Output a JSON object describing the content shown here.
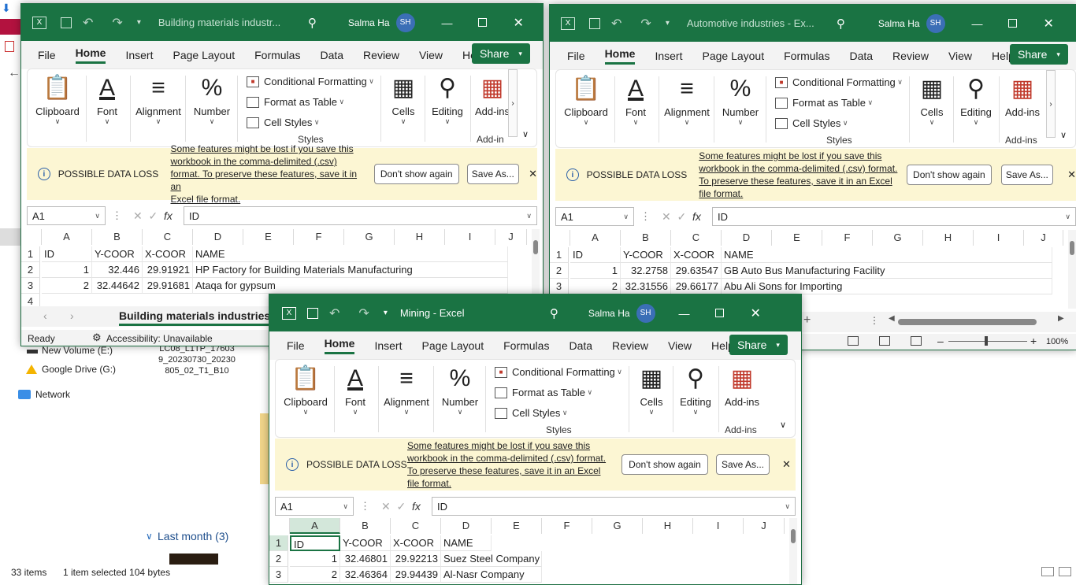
{
  "explorer": {
    "items": [
      "New Volume (E:)",
      "Google Drive (G:)",
      "Network"
    ],
    "filename": "LC08_L1TP_176039_20230730_20230805_02_T1_B10",
    "last_month": "Last month (3)",
    "status_count": "33 items",
    "status_sel": "1 item selected  104 bytes"
  },
  "common": {
    "user": "Salma Ha",
    "initials": "SH",
    "share": "Share",
    "menu": [
      "File",
      "Home",
      "Insert",
      "Page Layout",
      "Formulas",
      "Data",
      "Review",
      "View",
      "Help"
    ],
    "clipboard": "Clipboard",
    "font": "Font",
    "alignment": "Alignment",
    "number": "Number",
    "cond_fmt": "Conditional Formatting",
    "fmt_table": "Format as Table",
    "cell_styles": "Cell Styles",
    "styles": "Styles",
    "cells": "Cells",
    "editing": "Editing",
    "addins": "Add-ins",
    "addin_short": "Add-in",
    "warn_title": "POSSIBLE DATA LOSS",
    "warn_msg_l1": "Some features might be lost if you save this",
    "warn_msg_l2": "workbook in the comma-delimited (.csv)",
    "warn_msg_l3": "format. To preserve these features, save it in an",
    "warn_msg_l4": "Excel file format.",
    "warnb_l1": "Some features might be lost if you save this",
    "warnb_l2": "workbook in the comma-delimited (.csv) format.",
    "warnb_l3": "To preserve these features, save it in an Excel",
    "warnb_l4": "file format.",
    "dont_show": "Don't show again",
    "save_as": "Save As...",
    "cellref": "A1",
    "formula": "ID",
    "fx": "fx",
    "columns": [
      "A",
      "B",
      "C",
      "D",
      "E",
      "F",
      "G",
      "H",
      "I",
      "J"
    ],
    "status_ready": "Ready",
    "accessibility": "Accessibility: Unavailable",
    "zoom": "100%"
  },
  "win1": {
    "title": "Building materials industr...",
    "sheet_tab": "Building materials industries",
    "rows": [
      [
        "ID",
        "Y-COOR",
        "X-COOR",
        "NAME"
      ],
      [
        "1",
        "32.446",
        "29.91921",
        "HP Factory for Building Materials Manufacturing"
      ],
      [
        "2",
        "32.44642",
        "29.91681",
        "Ataqa for gypsum"
      ]
    ]
  },
  "win2": {
    "title": "Automotive industries - Ex...",
    "rows": [
      [
        "ID",
        "Y-COOR",
        "X-COOR",
        "NAME"
      ],
      [
        "1",
        "32.2758",
        "29.63547",
        "GB Auto Bus Manufacturing Facility"
      ],
      [
        "2",
        "32.31556",
        "29.66177",
        "Abu Ali Sons for Importing"
      ]
    ]
  },
  "win3": {
    "title": "Mining  -  Excel",
    "rows": [
      [
        "ID",
        "Y-COOR",
        "X-COOR",
        "NAME"
      ],
      [
        "1",
        "32.46801",
        "29.92213",
        "Suez Steel Company"
      ],
      [
        "2",
        "32.46364",
        "29.94439",
        "Al-Nasr Company"
      ]
    ]
  }
}
